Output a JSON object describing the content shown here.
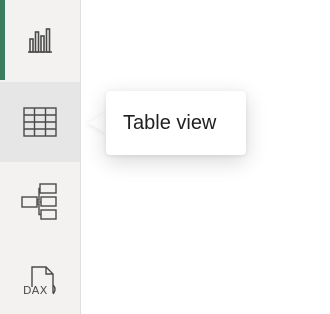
{
  "colors": {
    "rail_background": "#f3f2f1",
    "active_indicator": "#3a7d5b",
    "hover_background": "#e6e6e6",
    "icon_stroke": "#4a4a4a"
  },
  "rail": {
    "items": [
      {
        "id": "report-view",
        "icon": "bar-chart-icon",
        "active": true,
        "hovered": false
      },
      {
        "id": "table-view",
        "icon": "table-grid-icon",
        "active": false,
        "hovered": true
      },
      {
        "id": "model-view",
        "icon": "model-diagram-icon",
        "active": false,
        "hovered": false
      },
      {
        "id": "dax-query-view",
        "icon": "dax-document-icon",
        "active": false,
        "hovered": false
      }
    ],
    "dax_icon_text": "DAX"
  },
  "tooltip": {
    "text": "Table view"
  }
}
